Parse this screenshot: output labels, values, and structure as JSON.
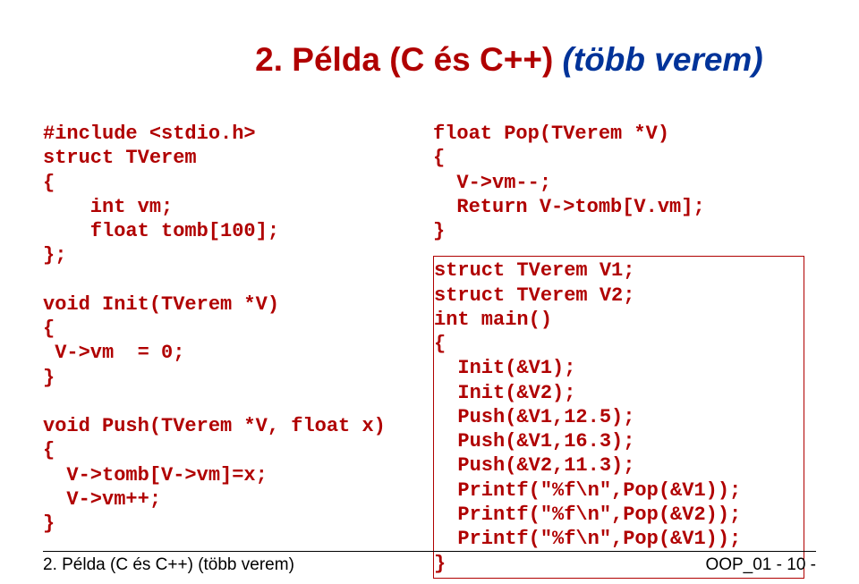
{
  "title": {
    "main": "2. Példa (C és C++)",
    "paren": " (több verem)"
  },
  "left_code": "#include <stdio.h>\nstruct TVerem\n{\n    int vm;\n    float tomb[100];\n};\n\nvoid Init(TVerem *V)\n{\n V->vm  = 0;\n}\n\nvoid Push(TVerem *V, float x)\n{\n  V->tomb[V->vm]=x;\n  V->vm++;\n}",
  "right_top_code": "float Pop(TVerem *V)\n{\n  V->vm--;\n  Return V->tomb[V.vm];\n}",
  "right_box_code": "struct TVerem V1;\nstruct TVerem V2;\nint main()\n{\n  Init(&V1);\n  Init(&V2);\n  Push(&V1,12.5);\n  Push(&V1,16.3);\n  Push(&V2,11.3);\n  Printf(\"%f\\n\",Pop(&V1));\n  Printf(\"%f\\n\",Pop(&V2));\n  Printf(\"%f\\n\",Pop(&V1));\n}",
  "footer": {
    "left": "2. Példa (C és C++) (több verem)",
    "right": "OOP_01        - 10 -"
  }
}
